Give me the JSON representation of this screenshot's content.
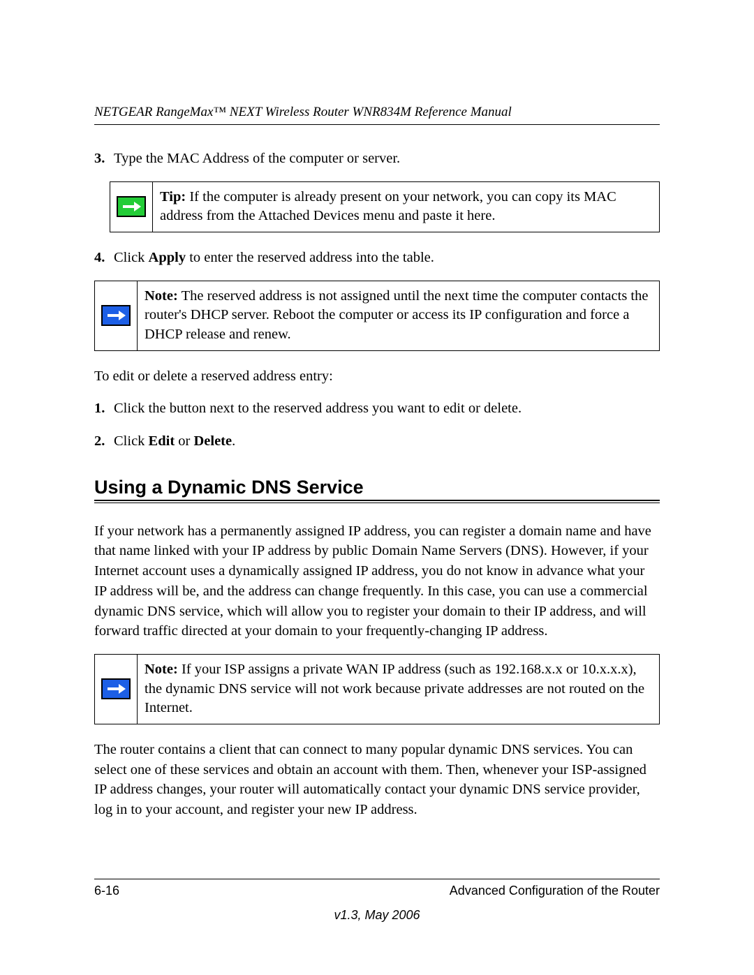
{
  "header": {
    "title": "NETGEAR RangeMax™ NEXT Wireless Router WNR834M Reference Manual"
  },
  "step3": {
    "num": "3.",
    "text": "Type the MAC Address of the computer or server."
  },
  "tipBox": {
    "lead": "Tip:",
    "text": " If the computer is already present on your network, you can copy its MAC address from the Attached Devices menu and paste it here."
  },
  "step4": {
    "num": "4.",
    "pre": "Click ",
    "bold": "Apply",
    "post": " to enter the reserved address into the table."
  },
  "noteBox1": {
    "lead": "Note:",
    "text": " The reserved address is not assigned until the next time the computer contacts the router's DHCP server. Reboot the computer or access its IP configuration and force a DHCP release and renew."
  },
  "editIntro": "To edit or delete a reserved address entry:",
  "editStep1": {
    "num": "1.",
    "text": "Click the button next to the reserved address you want to edit or delete."
  },
  "editStep2": {
    "num": "2.",
    "pre": "Click ",
    "b1": "Edit",
    "mid": " or ",
    "b2": "Delete",
    "post": "."
  },
  "sectionHeading": "Using a Dynamic DNS Service",
  "para1": "If your network has a permanently assigned IP address, you can register a domain name and have that name linked with your IP address by public Domain Name Servers (DNS). However, if your Internet account uses a dynamically assigned IP address, you do not know in advance what your IP address will be, and the address can change frequently. In this case, you can use a commercial dynamic DNS service, which will allow you to register your domain to their IP address, and will forward traffic directed at your domain to your frequently-changing IP address.",
  "noteBox2": {
    "lead": "Note:",
    "text": " If your ISP assigns a private WAN IP address (such as 192.168.x.x or 10.x.x.x), the dynamic DNS service will not work because private addresses are not routed on the Internet."
  },
  "para2": "The router contains a client that can connect to many popular dynamic DNS services. You can select one of these services and obtain an account with them. Then, whenever your ISP-assigned IP address changes, your router will automatically contact your dynamic DNS service provider, log in to your account, and register your new IP address.",
  "footer": {
    "pageNum": "6-16",
    "section": "Advanced Configuration of the Router",
    "version": "v1.3, May 2006"
  }
}
